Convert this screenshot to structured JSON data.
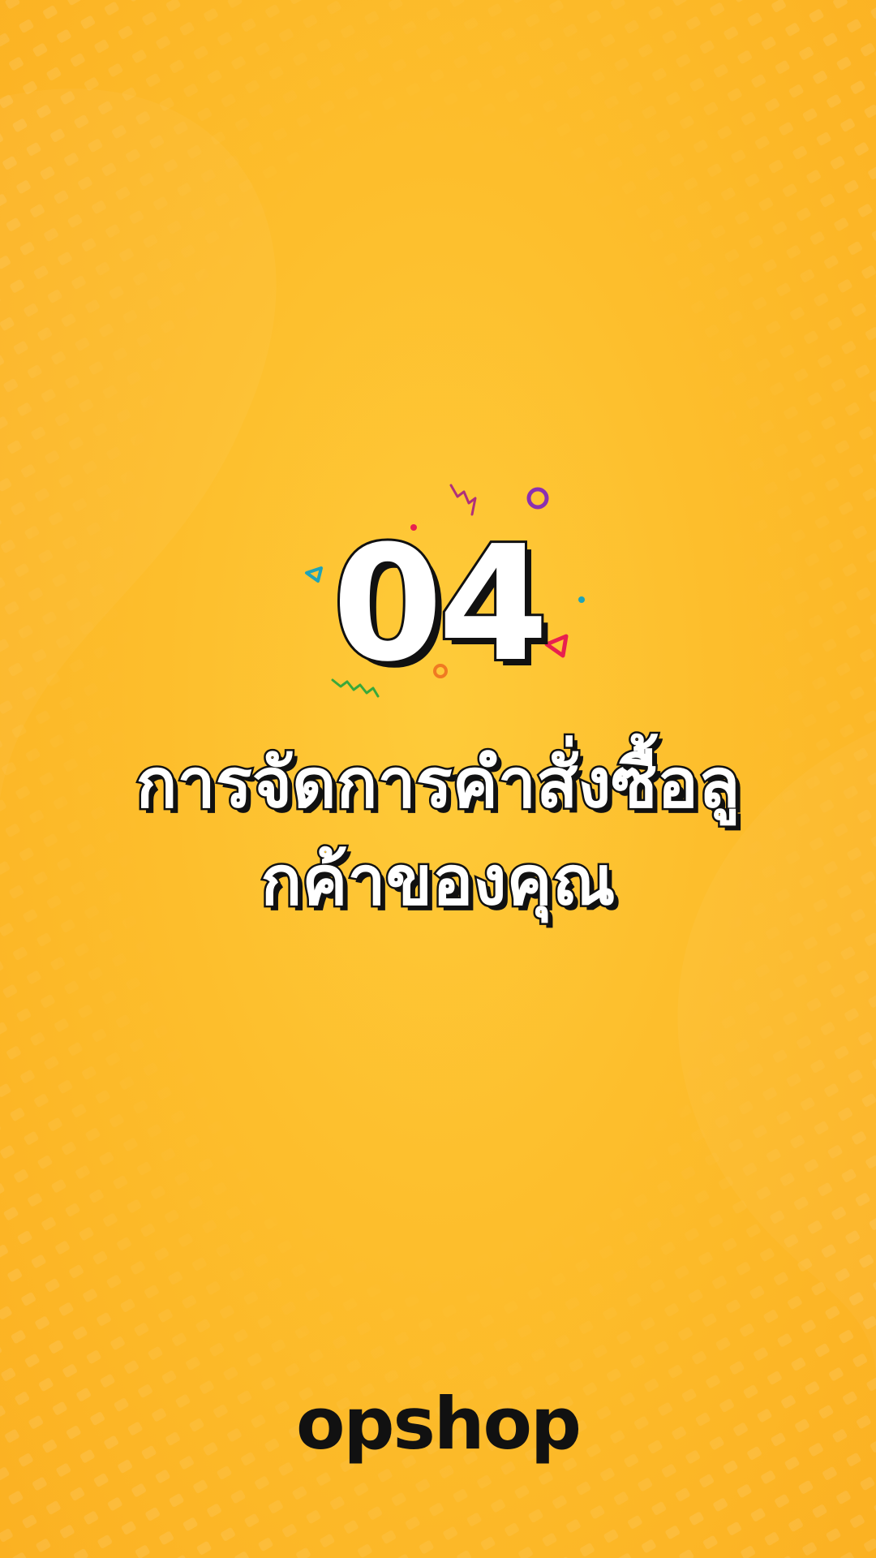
{
  "slide": {
    "step_number": "04",
    "title_line_1": "การจัดการคำสั่งซื้อลู",
    "title_line_2": "กค้าของคุณ"
  },
  "brand": {
    "logo_text": "opshop"
  },
  "colors": {
    "background": "#fdbe2c",
    "text_fill": "#ffffff",
    "text_outline": "#111111",
    "confetti_purple": "#8b2fb0",
    "confetti_magenta": "#b0307a",
    "confetti_red": "#e8204f",
    "confetti_teal": "#1fa3b8",
    "confetti_green": "#3aa83a",
    "confetti_orange": "#f07a22"
  },
  "decorations": {
    "confetti_icons": [
      "zigzag-icon",
      "ring-icon",
      "dot-icon",
      "triangle-icon",
      "squiggle-icon"
    ]
  }
}
